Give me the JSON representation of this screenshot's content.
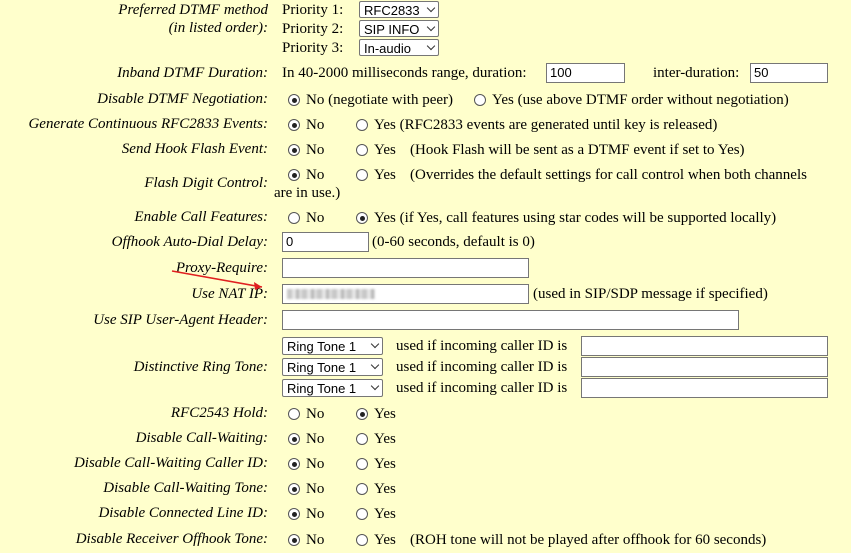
{
  "dtmf_method": {
    "label": "Preferred DTMF method",
    "label2": "(in listed order):",
    "priorities": [
      {
        "label": "Priority 1:",
        "value": "RFC2833"
      },
      {
        "label": "Priority 2:",
        "value": "SIP INFO"
      },
      {
        "label": "Priority 3:",
        "value": "In-audio"
      }
    ]
  },
  "inband_duration": {
    "label": "Inband DTMF Duration:",
    "text": "In 40-2000 milliseconds range, duration:",
    "duration": "100",
    "inter_label": "inter-duration:",
    "inter_duration": "50"
  },
  "disable_dtmf_negotiation": {
    "label": "Disable DTMF Negotiation:",
    "opt_no": "No (negotiate with peer)",
    "opt_yes": "Yes (use above DTMF order without negotiation)"
  },
  "gen_rfc2833": {
    "label": "Generate Continuous RFC2833 Events:",
    "opt_no": "No",
    "opt_yes": "Yes (RFC2833 events are generated until key is released)"
  },
  "hook_flash": {
    "label": "Send Hook Flash Event:",
    "opt_no": "No",
    "opt_yes": "Yes",
    "note": "(Hook Flash will be sent as a DTMF event if set to Yes)"
  },
  "flash_digit": {
    "label": "Flash Digit Control:",
    "opt_no": "No",
    "opt_yes": "Yes",
    "note": "(Overrides the default settings for call control when both channels",
    "note2": "are in use.)"
  },
  "call_features": {
    "label": "Enable Call Features:",
    "opt_no": "No",
    "opt_yes": "Yes (if Yes, call features using star codes will be supported locally)"
  },
  "offhook_delay": {
    "label": "Offhook Auto-Dial Delay:",
    "value": "0",
    "note": "(0-60 seconds, default is 0)"
  },
  "proxy_require": {
    "label": "Proxy-Require:",
    "value": ""
  },
  "nat_ip": {
    "label": "Use NAT IP:",
    "note": "(used in SIP/SDP message if specified)"
  },
  "user_agent": {
    "label": "Use SIP User-Agent Header:",
    "value": ""
  },
  "ring_tone": {
    "label": "Distinctive Ring Tone:",
    "rows": [
      {
        "select": "Ring Tone 1",
        "text": "used if incoming caller ID is",
        "value": ""
      },
      {
        "select": "Ring Tone 1",
        "text": "used if incoming caller ID is",
        "value": ""
      },
      {
        "select": "Ring Tone 1",
        "text": "used if incoming caller ID is",
        "value": ""
      }
    ]
  },
  "rfc2543_hold": {
    "label": "RFC2543 Hold:",
    "opt_no": "No",
    "opt_yes": "Yes"
  },
  "disable_cw": {
    "label": "Disable Call-Waiting:",
    "opt_no": "No",
    "opt_yes": "Yes"
  },
  "disable_cw_cid": {
    "label": "Disable Call-Waiting Caller ID:",
    "opt_no": "No",
    "opt_yes": "Yes"
  },
  "disable_cw_tone": {
    "label": "Disable Call-Waiting Tone:",
    "opt_no": "No",
    "opt_yes": "Yes"
  },
  "disable_connected_line": {
    "label": "Disable Connected Line ID:",
    "opt_no": "No",
    "opt_yes": "Yes"
  },
  "disable_roh": {
    "label": "Disable Receiver Offhook Tone:",
    "opt_no": "No",
    "opt_yes": "Yes",
    "note": "(ROH tone will not be played after offhook for 60 seconds)"
  },
  "colors": {
    "background": "#ffffcc",
    "annotation_arrow": "#e02020"
  }
}
